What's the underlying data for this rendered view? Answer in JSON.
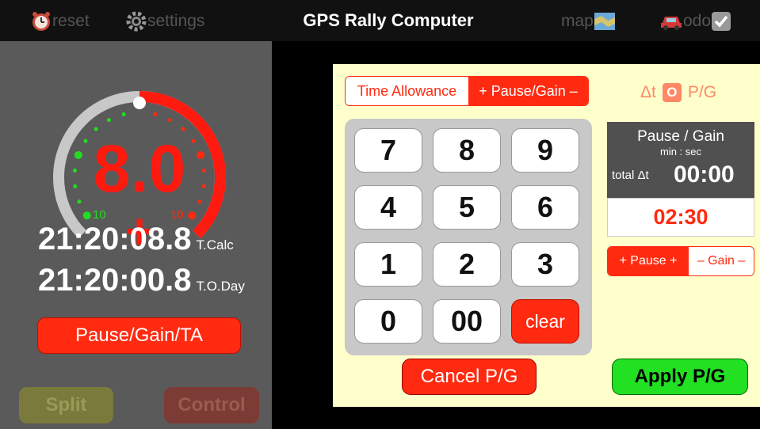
{
  "topbar": {
    "reset_label": "reset",
    "settings_label": "settings",
    "title": "GPS Rally Computer",
    "map_label": "map",
    "odo_label": "odo"
  },
  "gauge": {
    "value": "8.0",
    "sign": "+",
    "left_scale": "10",
    "right_scale": "10",
    "level": 0.55
  },
  "times": {
    "calc_time": "21:20:08.8",
    "calc_label": "T.Calc",
    "day_time": "21:20:00.8",
    "day_label": "T.O.Day"
  },
  "buttons": {
    "pause_gain_ta": "Pause/Gain/TA",
    "split": "Split",
    "control": "Control",
    "cancel": "Cancel P/G",
    "apply": "Apply P/G"
  },
  "segment_top": {
    "time_allowance": "Time Allowance",
    "pause_gain": "+ Pause/Gain –"
  },
  "delta_label": {
    "dt": "Δt",
    "box": "O",
    "pg": "P/G"
  },
  "keypad": {
    "keys": [
      "7",
      "8",
      "9",
      "4",
      "5",
      "6",
      "1",
      "2",
      "3",
      "0",
      "00",
      "clear"
    ]
  },
  "pause_gain_box": {
    "title": "Pause / Gain",
    "subtitle": "min : sec",
    "total_label": "total Δt",
    "total_value": "00:00",
    "entry_value": "02:30"
  },
  "segment_pg": {
    "pause": "+ Pause +",
    "gain": "– Gain –"
  },
  "colors": {
    "accent_red": "#ff2a10",
    "apply_green": "#22e022",
    "panel_yellow": "#ffffcc"
  }
}
